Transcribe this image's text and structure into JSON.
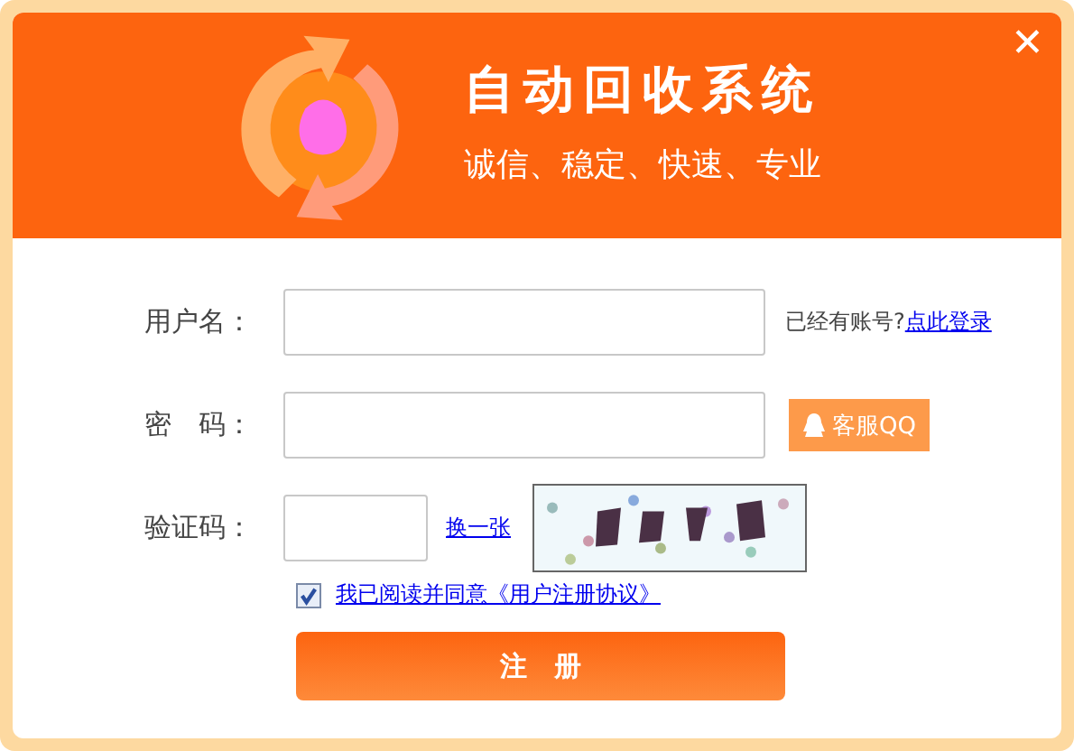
{
  "header": {
    "title": "自动回收系统",
    "slogan": "诚信、稳定、快速、专业",
    "close": "✕"
  },
  "form": {
    "username": {
      "label": "用户名：",
      "hint": "已经有账号?",
      "login_link": "点此登录"
    },
    "password": {
      "label": "密　码：",
      "service_button": "客服QQ"
    },
    "captcha": {
      "label": "验证码：",
      "refresh_link": "换一张"
    },
    "agreement": {
      "checked": true,
      "text": "我已阅读并同意《用户注册协议》"
    },
    "submit": "注　册"
  }
}
